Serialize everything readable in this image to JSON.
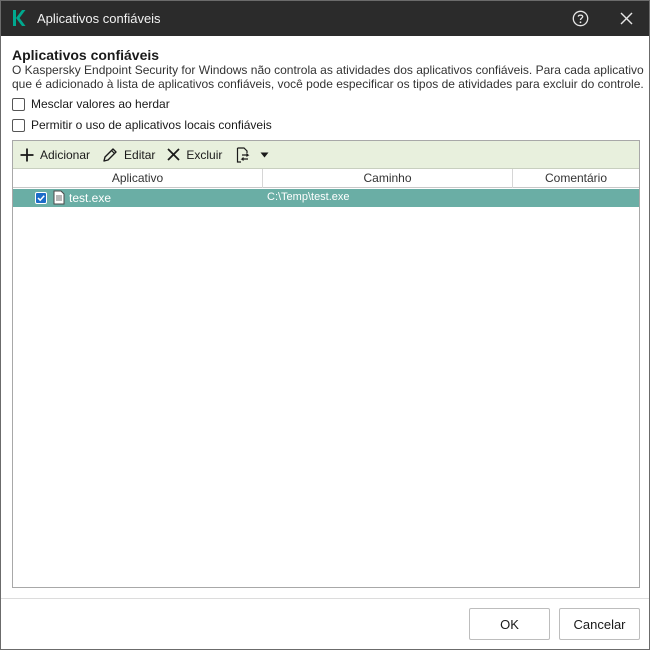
{
  "window": {
    "title": "Aplicativos confiáveis",
    "title_color": "#2b2b2b",
    "brand_color": "#00a88e"
  },
  "content": {
    "heading": "Aplicativos confiáveis",
    "description": "O Kaspersky Endpoint Security for Windows não controla as atividades dos aplicativos confiáveis. Para cada aplicativo que é adicionado à lista de aplicativos confiáveis, você pode especificar os tipos de atividades para excluir do controle."
  },
  "options": [
    {
      "label": "Mesclar valores ao herdar",
      "checked": false
    },
    {
      "label": "Permitir o uso de aplicativos locais confiáveis",
      "checked": false
    }
  ],
  "toolbar": {
    "add_label": "Adicionar",
    "edit_label": "Editar",
    "delete_label": "Excluir",
    "bg_color": "#e8f0dd"
  },
  "table": {
    "columns": [
      "Aplicativo",
      "Caminho",
      "Comentário"
    ],
    "rows": [
      {
        "checked": true,
        "application": "test.exe",
        "path": "C:\\Temp\\test.exe",
        "comment": "",
        "selected": true
      }
    ],
    "selected_color": "#6aaea5"
  },
  "footer": {
    "ok_label": "OK",
    "cancel_label": "Cancelar"
  }
}
